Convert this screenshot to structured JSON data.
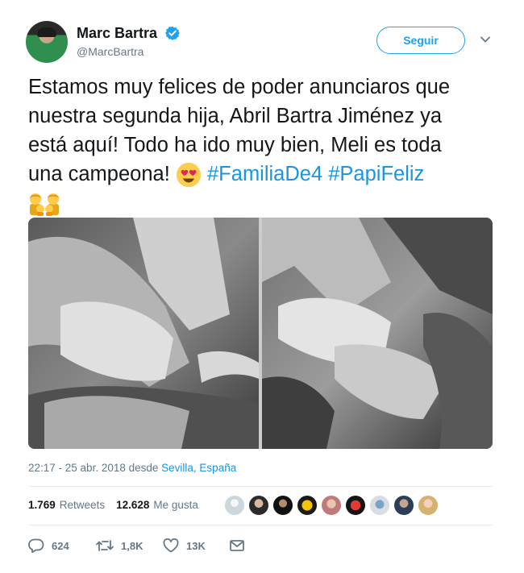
{
  "user": {
    "name": "Marc Bartra",
    "handle": "@MarcBartra",
    "follow_label": "Seguir"
  },
  "tweet": {
    "text_line1": "Estamos muy felices de poder anunciaros que",
    "text_line2": "nuestra segunda hija, Abril Bartra Jiménez ya",
    "text_line3": "está aquí! Todo ha ido muy bien, Meli es toda",
    "text_line4_start": "una campeona!",
    "hashtag1": "#FamiliaDe4",
    "hashtag2": "#PapiFeliz"
  },
  "meta": {
    "timestamp": "22:17 - 25 abr. 2018 desde",
    "location": "Sevilla, España"
  },
  "stats": {
    "retweets_count": "1.769",
    "retweets_label": "Retweets",
    "likes_count": "12.628",
    "likes_label": "Me gusta"
  },
  "actions": {
    "reply_count": "624",
    "retweet_count": "1,8K",
    "like_count": "13K"
  },
  "colors": {
    "link": "#1b95e0",
    "follow": "#1da1f2",
    "secondary": "#657786"
  },
  "icons": [
    "verified-badge-icon",
    "chevron-down-icon",
    "heart-eyes-emoji-icon",
    "family-emoji-icon",
    "reply-icon",
    "retweet-icon",
    "like-icon",
    "direct-message-icon"
  ]
}
